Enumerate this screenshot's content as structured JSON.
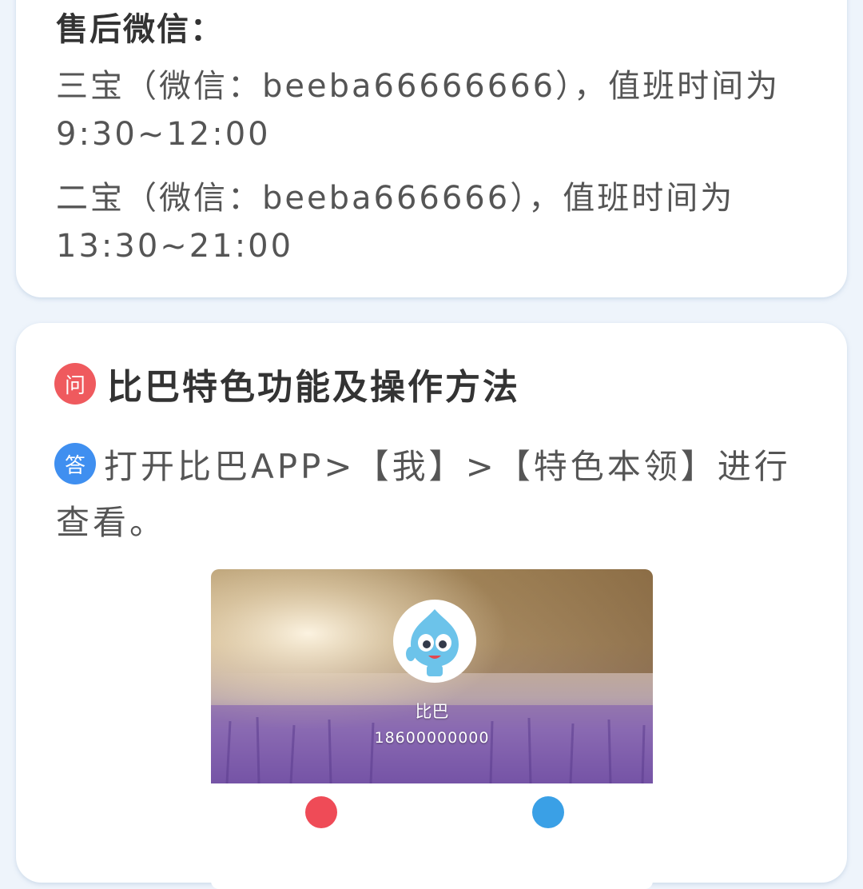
{
  "contact": {
    "title": "售后微信：",
    "line1": "三宝（微信：beeba66666666），值班时间为",
    "line2": "9:30~12:00",
    "line3": "二宝（微信：beeba666666），值班时间为",
    "line4": "13:30~21:00"
  },
  "faq": {
    "question_badge": "问",
    "question": "比巴特色功能及操作方法",
    "answer_badge": "答",
    "answer_line1": "打开比巴APP>【我】>【特色本领】进行",
    "answer_line2": "查看。"
  },
  "screenshot": {
    "username": "比巴",
    "phone": "18600000000",
    "avatar_icon": "beeba-mascot-icon"
  },
  "colors": {
    "page_bg": "#eef4fb",
    "question_badge": "#ef5a5e",
    "answer_badge": "#3f8ff0"
  }
}
